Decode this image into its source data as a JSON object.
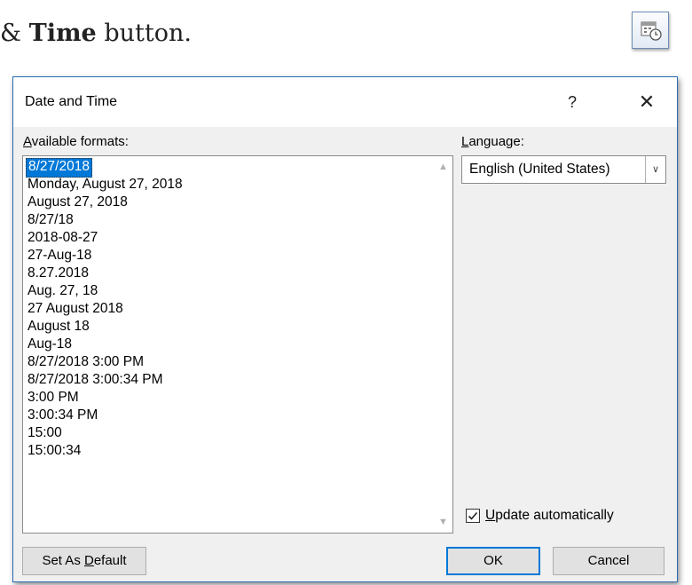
{
  "caption": {
    "prefix": "& ",
    "bold": "Time",
    "suffix": " button."
  },
  "corner_icon": "date-time-icon",
  "dialog": {
    "title": "Date and Time",
    "help_label": "?",
    "close_label": "✕",
    "formats_label_ul": "A",
    "formats_label_rest": "vailable formats:",
    "formats": [
      "8/27/2018",
      "Monday, August 27, 2018",
      "August 27, 2018",
      "8/27/18",
      "2018-08-27",
      "27-Aug-18",
      "8.27.2018",
      "Aug. 27, 18",
      "27 August 2018",
      "August 18",
      "Aug-18",
      "8/27/2018 3:00 PM",
      "8/27/2018 3:00:34 PM",
      "3:00 PM",
      "3:00:34 PM",
      "15:00",
      "15:00:34"
    ],
    "selected_format": "8/27/2018",
    "language_label_ul": "L",
    "language_label_rest": "anguage:",
    "language_value": "English (United States)",
    "update_checked": true,
    "update_label_ul": "U",
    "update_label_rest": "pdate automatically",
    "set_default_pre": "Set As ",
    "set_default_ul": "D",
    "set_default_post": "efault",
    "ok_label": "OK",
    "cancel_label": "Cancel"
  }
}
